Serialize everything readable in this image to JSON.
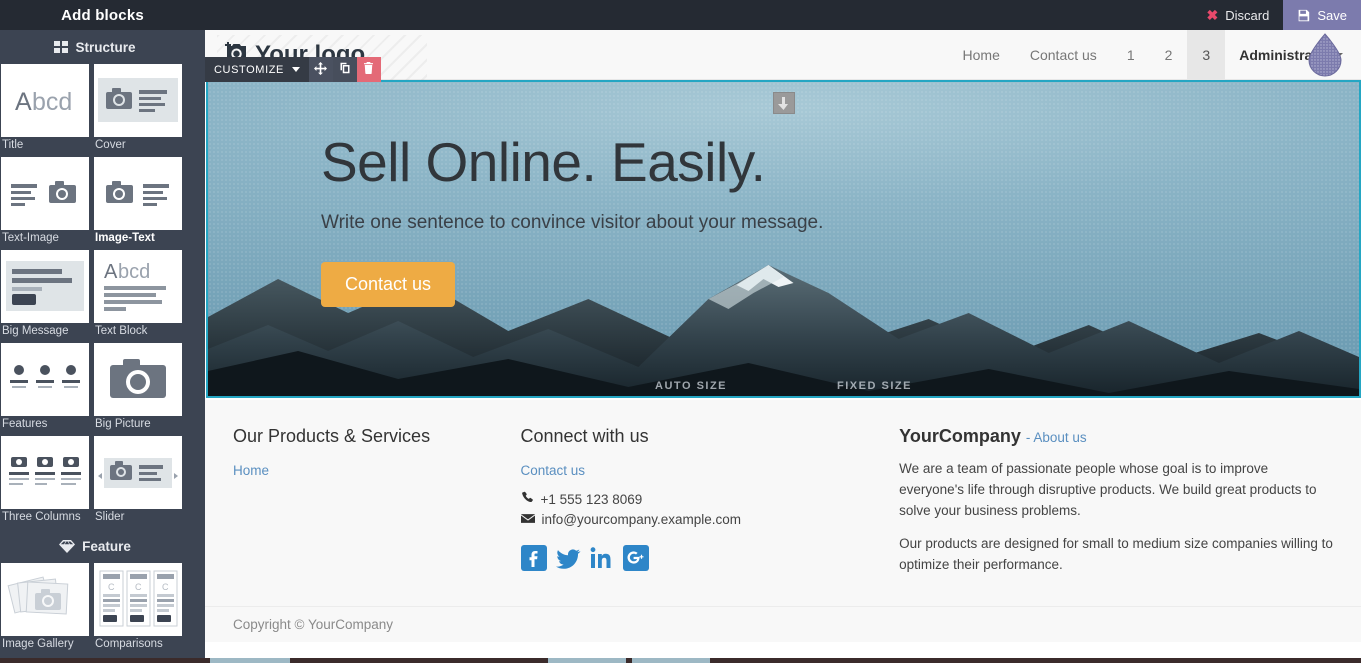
{
  "topbar": {
    "addblocks_title": "Add blocks",
    "discard_label": "Discard",
    "save_label": "Save",
    "discard_icon": "x-icon",
    "save_icon": "floppy-disk-icon"
  },
  "sidebar": {
    "sections": [
      {
        "title": "Structure",
        "icon": "grid-squares-icon",
        "blocks": [
          {
            "label": "Title",
            "thumb": "title-thumb",
            "highlight": false
          },
          {
            "label": "Cover",
            "thumb": "cover-thumb",
            "highlight": false
          },
          {
            "label": "Text-Image",
            "thumb": "text-image-thumb",
            "highlight": false
          },
          {
            "label": "Image-Text",
            "thumb": "image-text-thumb",
            "highlight": true
          },
          {
            "label": "Big Message",
            "thumb": "big-message-thumb",
            "highlight": false
          },
          {
            "label": "Text Block",
            "thumb": "text-block-thumb",
            "highlight": false
          },
          {
            "label": "Features",
            "thumb": "features-thumb",
            "highlight": false
          },
          {
            "label": "Big Picture",
            "thumb": "big-picture-thumb",
            "highlight": false
          },
          {
            "label": "Three Columns",
            "thumb": "three-columns-thumb",
            "highlight": false
          },
          {
            "label": "Slider",
            "thumb": "slider-thumb",
            "highlight": false
          }
        ]
      },
      {
        "title": "Feature",
        "icon": "diamond-icon",
        "blocks": [
          {
            "label": "Image Gallery",
            "thumb": "image-gallery-thumb",
            "highlight": false
          },
          {
            "label": "Comparisons",
            "thumb": "comparisons-thumb",
            "highlight": false
          }
        ]
      }
    ],
    "scrollbar": {
      "up_arrow": "▲",
      "down_arrow": "▼"
    }
  },
  "customize_toolbar": {
    "label": "CUSTOMIZE",
    "dropdown_icon": "chevron-down-icon",
    "move_icon": "move-arrows-icon",
    "duplicate_icon": "duplicate-icon",
    "delete_icon": "trash-icon"
  },
  "site": {
    "nav": {
      "logo_text": "Your logo",
      "logo_icon": "add-image-icon",
      "items": [
        {
          "label": "Home",
          "active": false
        },
        {
          "label": "Contact us",
          "active": false
        },
        {
          "label": "1",
          "active": false
        },
        {
          "label": "2",
          "active": false
        },
        {
          "label": "3",
          "active": true
        }
      ],
      "user": "Administrator",
      "user_caret": "caret-down-icon"
    },
    "hero": {
      "heading": "Sell Online. Easily.",
      "subheading": "Write one sentence to convince visitor about your message.",
      "button_label": "Contact us",
      "button_color": "#eeab44",
      "selection_color": "#24a6c3",
      "drag_handle_icon": "arrow-down-handle-icon",
      "size_left_label": "AUTO SIZE",
      "size_right_label": "FIXED SIZE"
    },
    "footer": {
      "col1": {
        "heading": "Our Products & Services",
        "links": [
          "Home"
        ]
      },
      "col2": {
        "heading": "Connect with us",
        "links": [
          "Contact us"
        ],
        "phone": "+1 555 123 8069",
        "phone_icon": "phone-icon",
        "email": "info@yourcompany.example.com",
        "email_icon": "envelope-icon",
        "socials": [
          "facebook-icon",
          "twitter-icon",
          "linkedin-icon",
          "googleplus-icon"
        ]
      },
      "col3": {
        "heading": "YourCompany",
        "heading_link": "- About us",
        "paragraphs": [
          "We are a team of passionate people whose goal is to improve everyone's life through disruptive products. We build great products to solve your business problems.",
          "Our products are designed for small to medium size companies willing to optimize their performance."
        ]
      },
      "copyright": "Copyright © YourCompany"
    }
  }
}
